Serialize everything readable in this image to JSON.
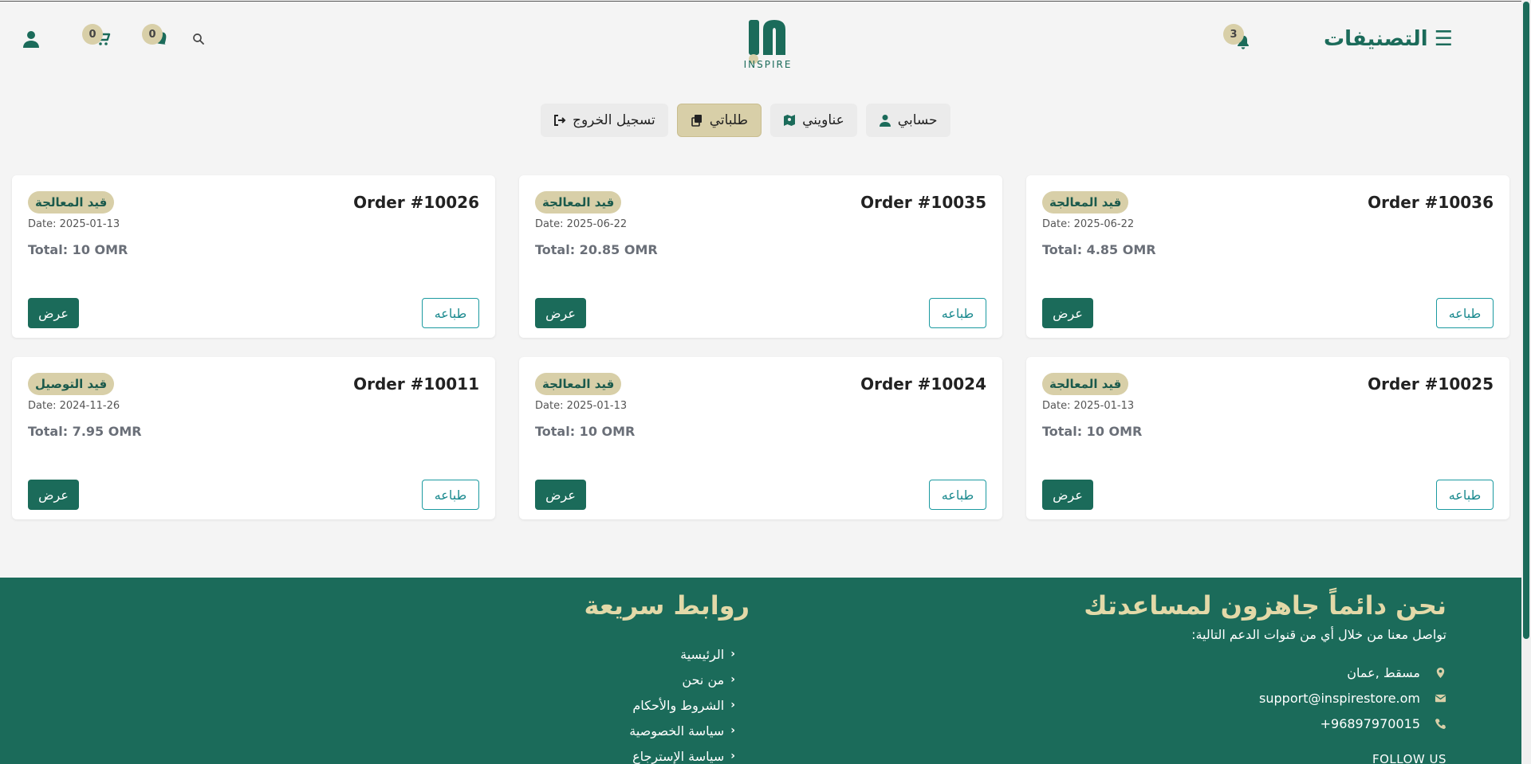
{
  "colors": {
    "primary": "#1b6b5a",
    "accent": "#d8cfa8",
    "footer_title": "#e3d9a8"
  },
  "header": {
    "categories_label": "التصنيفات",
    "notifications_count": "3",
    "logo_text": "INSPIRE",
    "wishlist_count": "0",
    "cart_count": "0",
    "icons": [
      "menu-icon",
      "bell-icon",
      "search-icon",
      "heart-icon",
      "cart-icon",
      "user-icon"
    ]
  },
  "tabs": [
    {
      "label": "حسابي",
      "icon": "user-icon"
    },
    {
      "label": "عناويني",
      "icon": "map-icon"
    },
    {
      "label": "طلباتي",
      "icon": "copy-icon",
      "active": true
    },
    {
      "label": "تسجيل الخروج",
      "icon": "logout-icon"
    }
  ],
  "orders": [
    {
      "number": "Order #10036",
      "status": "قيد المعالجة",
      "date": "Date: 2025-06-22",
      "total": "Total: 4.85 OMR"
    },
    {
      "number": "Order #10035",
      "status": "قيد المعالجة",
      "date": "Date: 2025-06-22",
      "total": "Total: 20.85 OMR"
    },
    {
      "number": "Order #10026",
      "status": "قيد المعالجة",
      "date": "Date: 2025-01-13",
      "total": "Total: 10 OMR"
    },
    {
      "number": "Order #10025",
      "status": "قيد المعالجة",
      "date": "Date: 2025-01-13",
      "total": "Total: 10 OMR"
    },
    {
      "number": "Order #10024",
      "status": "قيد المعالجة",
      "date": "Date: 2025-01-13",
      "total": "Total: 10 OMR"
    },
    {
      "number": "Order #10011",
      "status": "قيد التوصيل",
      "date": "Date: 2024-11-26",
      "total": "Total: 7.95 OMR"
    }
  ],
  "order_buttons": {
    "view": "عرض",
    "print": "طباعه"
  },
  "footer": {
    "support_title": "نحن دائماً جاهزون لمساعدتك",
    "support_subtitle": "تواصل معنا من خلال أي من قنوات الدعم التالية:",
    "location": "مسقط ,عمان",
    "email": "support@inspirestore.om",
    "phone": "+96897970015",
    "follow_label": "FOLLOW US",
    "links_title": "روابط سريعة",
    "links": [
      "الرئيسية",
      "من نحن",
      "الشروط والأحكام",
      "سياسة الخصوصية",
      "سياسة الإسترجاع"
    ]
  }
}
